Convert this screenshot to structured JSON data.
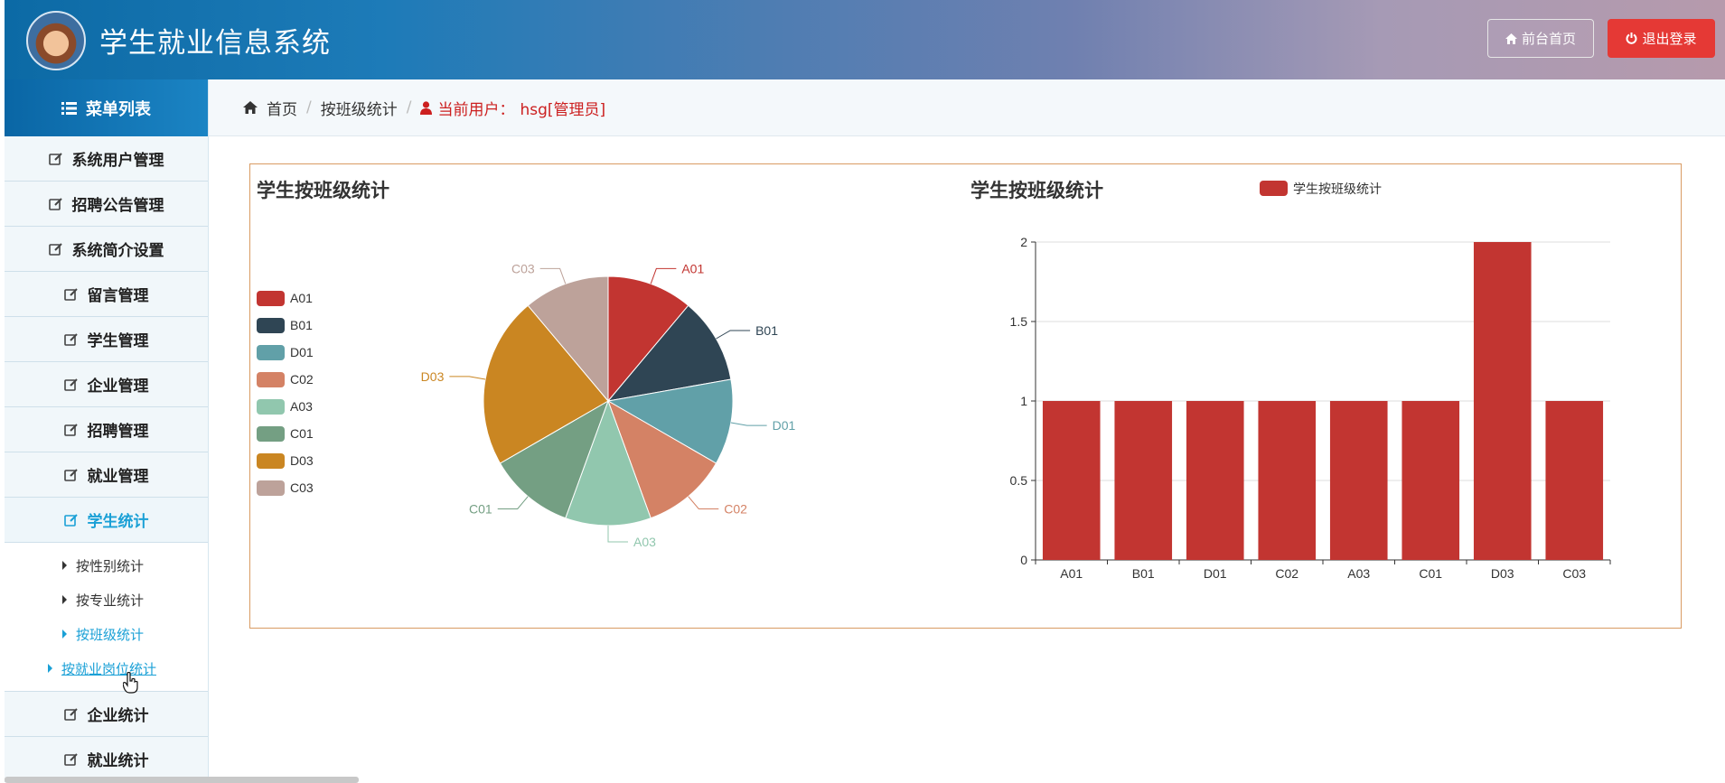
{
  "app": {
    "title": "学生就业信息系统"
  },
  "header": {
    "home_button": "前台首页",
    "logout_button": "退出登录"
  },
  "sidebar": {
    "menu_title": "菜单列表",
    "items": [
      {
        "label": "系统用户管理"
      },
      {
        "label": "招聘公告管理"
      },
      {
        "label": "系统简介设置"
      },
      {
        "label": "留言管理"
      },
      {
        "label": "学生管理"
      },
      {
        "label": "企业管理"
      },
      {
        "label": "招聘管理"
      },
      {
        "label": "就业管理"
      },
      {
        "label": "学生统计"
      },
      {
        "label": "企业统计"
      },
      {
        "label": "就业统计"
      }
    ],
    "sub_items": [
      {
        "label": "按性别统计"
      },
      {
        "label": "按专业统计"
      },
      {
        "label": "按班级统计"
      },
      {
        "label": "按就业岗位统计"
      }
    ]
  },
  "breadcrumb": {
    "home": "首页",
    "current": "按班级统计",
    "user_label": "当前用户：",
    "user_value": "hsg[管理员]"
  },
  "colors": {
    "accent": "#1aa0d6",
    "danger": "#e53935",
    "bar": "#c23531"
  },
  "chart_data": [
    {
      "type": "pie",
      "title": "学生按班级统计",
      "categories": [
        "A01",
        "B01",
        "D01",
        "C02",
        "A03",
        "C01",
        "D03",
        "C03"
      ],
      "values": [
        1,
        1,
        1,
        1,
        1,
        1,
        2,
        1
      ],
      "colors": [
        "#c23531",
        "#2f4554",
        "#61a0a8",
        "#d48265",
        "#91c7ae",
        "#749f83",
        "#ca8622",
        "#bda29a"
      ],
      "legend": "left"
    },
    {
      "type": "bar",
      "title": "学生按班级统计",
      "legend": "top",
      "series": [
        {
          "name": "学生按班级统计",
          "values": [
            1,
            1,
            1,
            1,
            1,
            1,
            2,
            1
          ]
        }
      ],
      "categories": [
        "A01",
        "B01",
        "D01",
        "C02",
        "A03",
        "C01",
        "D03",
        "C03"
      ],
      "yticks": [
        "0",
        "0.5",
        "1",
        "1.5",
        "2"
      ],
      "ylim": [
        0,
        2
      ],
      "grid": true
    }
  ]
}
